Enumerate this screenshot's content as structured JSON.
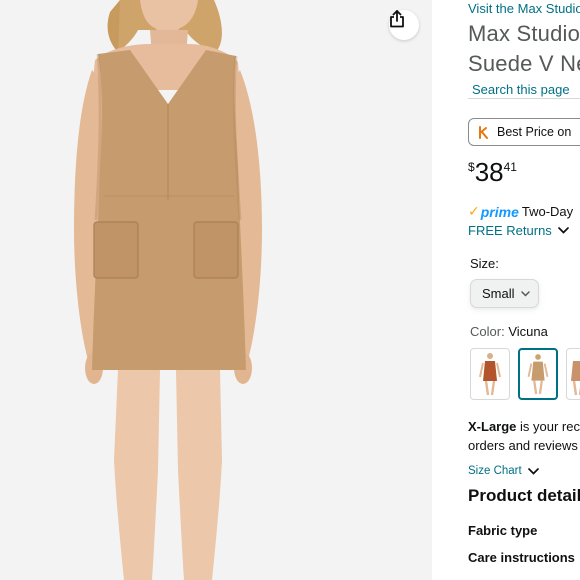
{
  "product_image": {
    "alt_desc": ""
  },
  "share": {
    "icon": "share-icon"
  },
  "info": {
    "visit_store": "Visit the Max Studio",
    "title_line1": "Max Studio",
    "title_line2": "Suede V Ne",
    "search_page": "Search this page",
    "best_price": "Best Price on",
    "price": {
      "symbol": "$",
      "whole": "38",
      "fraction": "41"
    },
    "prime": {
      "word": "prime",
      "delivery": "Two-Day"
    },
    "free_returns": "FREE Returns",
    "size_label": "Size:",
    "size_value": "Small",
    "color_label": "Color:",
    "color_value": "Vicuna",
    "fit_bold": "X-Large",
    "fit_rest": " is your rec",
    "fit_line2": "orders and reviews",
    "size_chart": "Size Chart",
    "details_heading": "Product detail",
    "fabric_type": "Fabric type",
    "care_instructions": "Care instructions"
  },
  "colors": {
    "link": "#007185",
    "prime_blue": "#1399ff",
    "prime_check": "#ffa41c",
    "title_gray": "#565959"
  }
}
